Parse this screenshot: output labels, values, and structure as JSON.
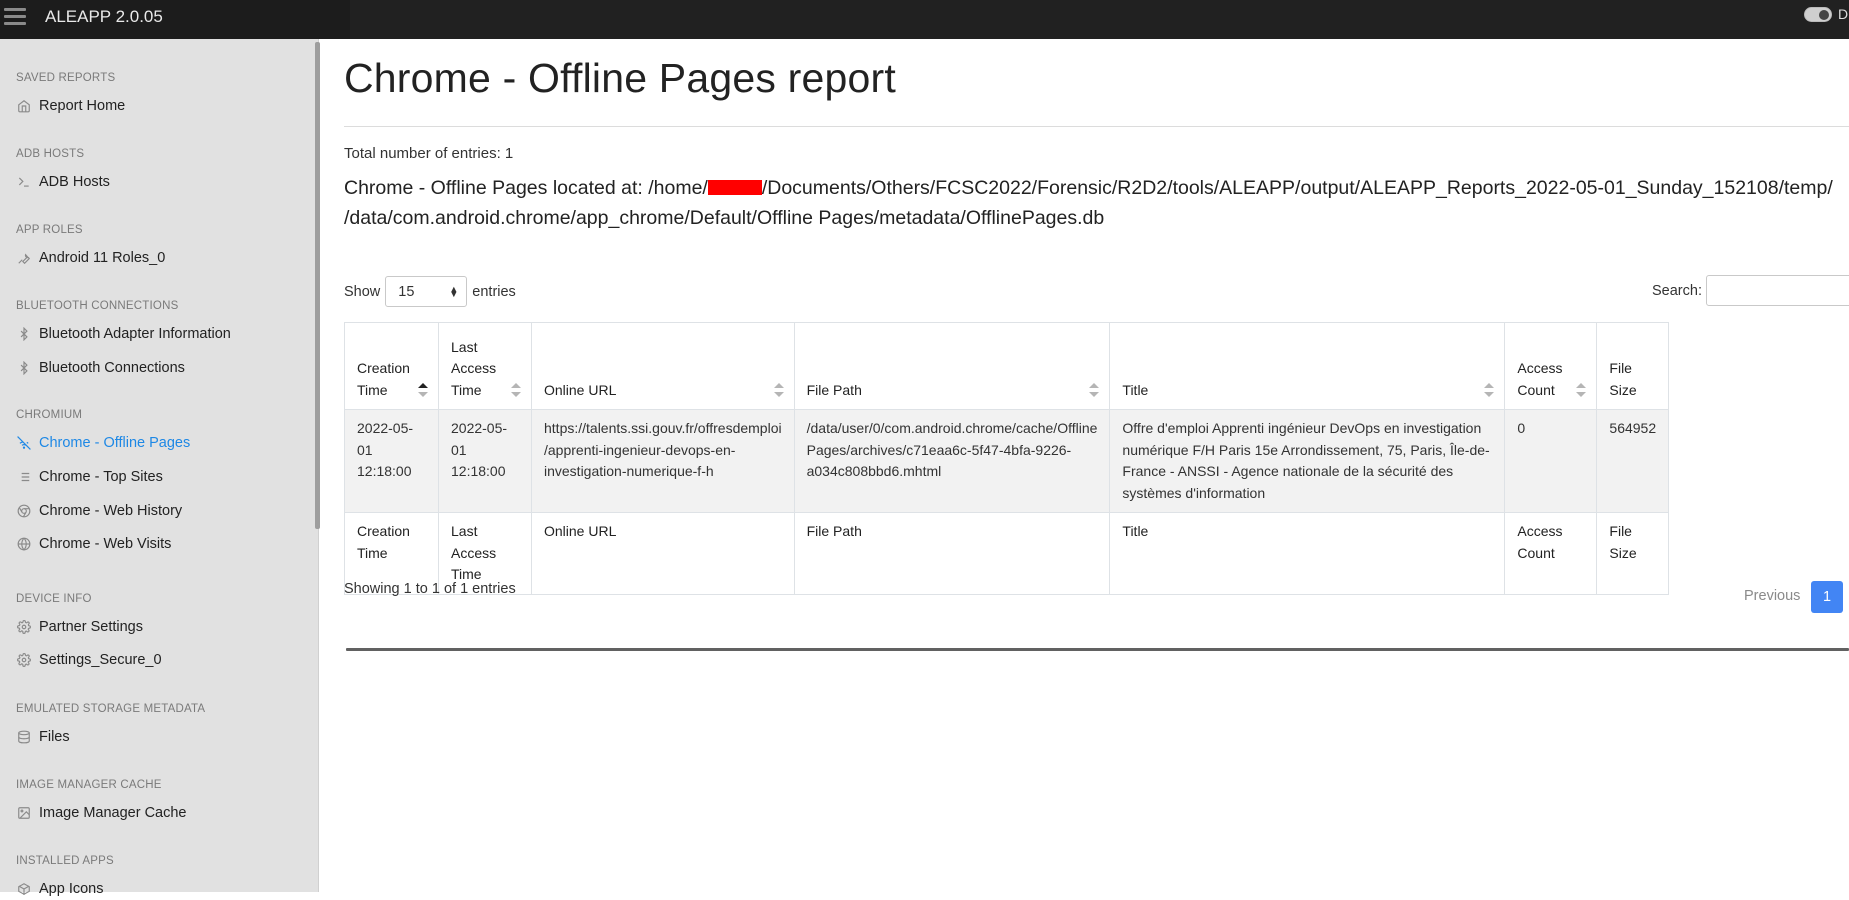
{
  "app": {
    "title": "ALEAPP 2.0.05",
    "toggle_label": "D"
  },
  "sidebar": {
    "sections": [
      {
        "heading": "SAVED REPORTS",
        "items": [
          {
            "label": "Report Home",
            "icon": "home-icon"
          }
        ]
      },
      {
        "heading": "ADB HOSTS",
        "items": [
          {
            "label": "ADB Hosts",
            "icon": "terminal-icon"
          }
        ]
      },
      {
        "heading": "APP ROLES",
        "items": [
          {
            "label": "Android 11 Roles_0",
            "icon": "tool-icon"
          }
        ]
      },
      {
        "heading": "BLUETOOTH CONNECTIONS",
        "items": [
          {
            "label": "Bluetooth Adapter Information",
            "icon": "bluetooth-icon"
          },
          {
            "label": "Bluetooth Connections",
            "icon": "bluetooth-icon"
          }
        ]
      },
      {
        "heading": "CHROMIUM",
        "items": [
          {
            "label": "Chrome - Offline Pages",
            "icon": "wifi-off-icon",
            "active": true
          },
          {
            "label": "Chrome - Top Sites",
            "icon": "list-icon"
          },
          {
            "label": "Chrome - Web History",
            "icon": "chrome-icon"
          },
          {
            "label": "Chrome - Web Visits",
            "icon": "globe-icon"
          }
        ]
      },
      {
        "heading": "DEVICE INFO",
        "items": [
          {
            "label": "Partner Settings",
            "icon": "settings-icon"
          },
          {
            "label": "Settings_Secure_0",
            "icon": "settings-icon"
          }
        ]
      },
      {
        "heading": "EMULATED STORAGE METADATA",
        "items": [
          {
            "label": "Files",
            "icon": "database-icon"
          }
        ]
      },
      {
        "heading": "IMAGE MANAGER CACHE",
        "items": [
          {
            "label": "Image Manager Cache",
            "icon": "image-icon"
          }
        ]
      },
      {
        "heading": "INSTALLED APPS",
        "items": [
          {
            "label": "App Icons",
            "icon": "package-icon"
          }
        ]
      }
    ]
  },
  "main": {
    "title": "Chrome - Offline Pages report",
    "total": "Total number of entries: 1",
    "located_line1_a": "Chrome - Offline Pages located at: /home/",
    "located_line1_b": "/Documents/Others/FCSC2022/Forensic/R2D2/tools/ALEAPP/output/ALEAPP_Reports_2022-05-01_Sunday_152108/temp/",
    "located_line2": "/data/com.android.chrome/app_chrome/Default/Offline Pages/metadata/OfflinePages.db",
    "show_label": "Show",
    "show_value": "15",
    "entries_label": "entries",
    "search_label": "Search:",
    "search_value": "",
    "columns": [
      {
        "header": "Creation Time",
        "footer": "Creation Time",
        "sorted": "asc"
      },
      {
        "header": "Last Access Time",
        "footer": "Last Access Time"
      },
      {
        "header": "Online URL",
        "footer": "Online URL"
      },
      {
        "header": "File Path",
        "footer": "File Path"
      },
      {
        "header": "Title",
        "footer": "Title"
      },
      {
        "header": "Access Count",
        "footer": "Access Count"
      },
      {
        "header": "File Size",
        "footer": "File Size"
      }
    ],
    "rows": [
      [
        "2022-05-01 12:18:00",
        "2022-05-01 12:18:00",
        "https://talents.ssi.gouv.fr/offresdemploi /apprenti-ingenieur-devops-en- investigation-numerique-f-h",
        "/data/user/0/com.android.chrome/cache/Offline Pages/archives/c71eaa6c-5f47-4bfa-9226-a034c808bbd6.mhtml",
        "Offre d'emploi Apprenti ingénieur DevOps en investigation numérique F/H Paris 15e Arrondissement, 75, Paris, Île-de-France - ANSSI - Agence nationale de la sécurité des systèmes d'information",
        "0",
        "564952"
      ]
    ],
    "showing": "Showing 1 to 1 of 1 entries",
    "prev_label": "Previous",
    "page_label": "1"
  },
  "colors": {
    "accent": "#1e88e5",
    "page_button": "#4285f4",
    "topbar": "#212121",
    "sidebar": "#e1e1e1",
    "redaction": "#ff0000"
  }
}
